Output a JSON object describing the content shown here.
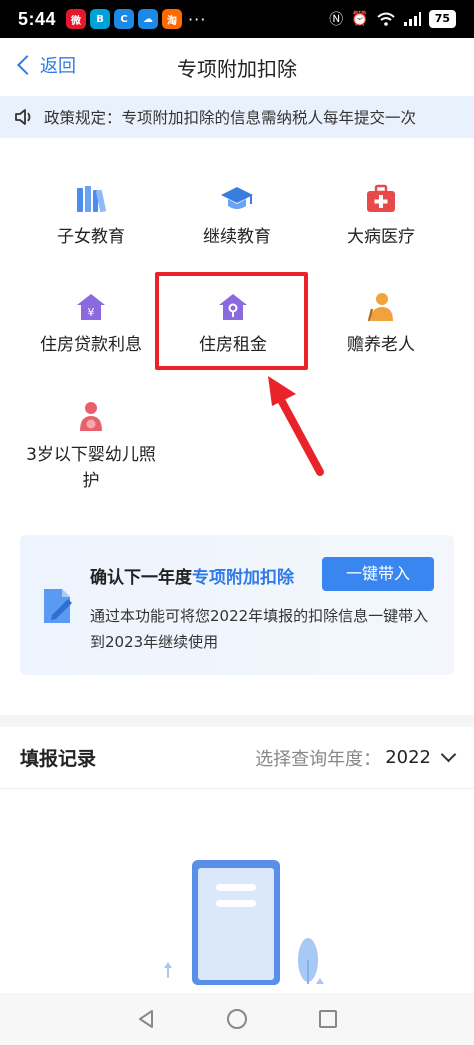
{
  "statusbar": {
    "time": "5:44",
    "apps": [
      {
        "name": "weibo-icon",
        "color": "#e6162d",
        "glyph": "微"
      },
      {
        "name": "bilibili-icon",
        "color": "#00a1d6",
        "glyph": "B"
      },
      {
        "name": "app-c-icon",
        "color": "#1e88e5",
        "glyph": "C"
      },
      {
        "name": "cloud-icon",
        "color": "#1e88e5",
        "glyph": "☁"
      },
      {
        "name": "taobao-icon",
        "color": "#ff6a00",
        "glyph": "淘"
      }
    ],
    "more": "···",
    "battery": "75"
  },
  "nav": {
    "back_label": "返回",
    "title": "专项附加扣除"
  },
  "notice": {
    "text": "政策规定：专项附加扣除的信息需纳税人每年提交一次"
  },
  "categories": [
    {
      "label": "子女教育",
      "icon": "books-icon",
      "color": "#4a8df2"
    },
    {
      "label": "继续教育",
      "icon": "graduation-cap-icon",
      "color": "#3a7de0"
    },
    {
      "label": "大病医疗",
      "icon": "medical-kit-icon",
      "color": "#e84a4a"
    },
    {
      "label": "住房贷款利息",
      "icon": "house-yen-icon",
      "color": "#8b6ae0"
    },
    {
      "label": "住房租金",
      "icon": "house-key-icon",
      "color": "#8b6ae0"
    },
    {
      "label": "赡养老人",
      "icon": "elderly-icon",
      "color": "#f0a23c"
    },
    {
      "label": "3岁以下婴幼儿照护",
      "icon": "mother-baby-icon",
      "color": "#e8606a"
    }
  ],
  "banner": {
    "title_prefix": "确认下一年度",
    "title_highlight": "专项附加扣除",
    "button_label": "一键带入",
    "description": "通过本功能可将您2022年填报的扣除信息一键带入到2023年继续使用"
  },
  "records": {
    "title": "填报记录",
    "year_prompt": "选择查询年度：",
    "year_value": "2022"
  },
  "colors": {
    "accent": "#2f7be5",
    "highlight_box": "#e8242a",
    "notice_bg": "#e9f1fc"
  }
}
